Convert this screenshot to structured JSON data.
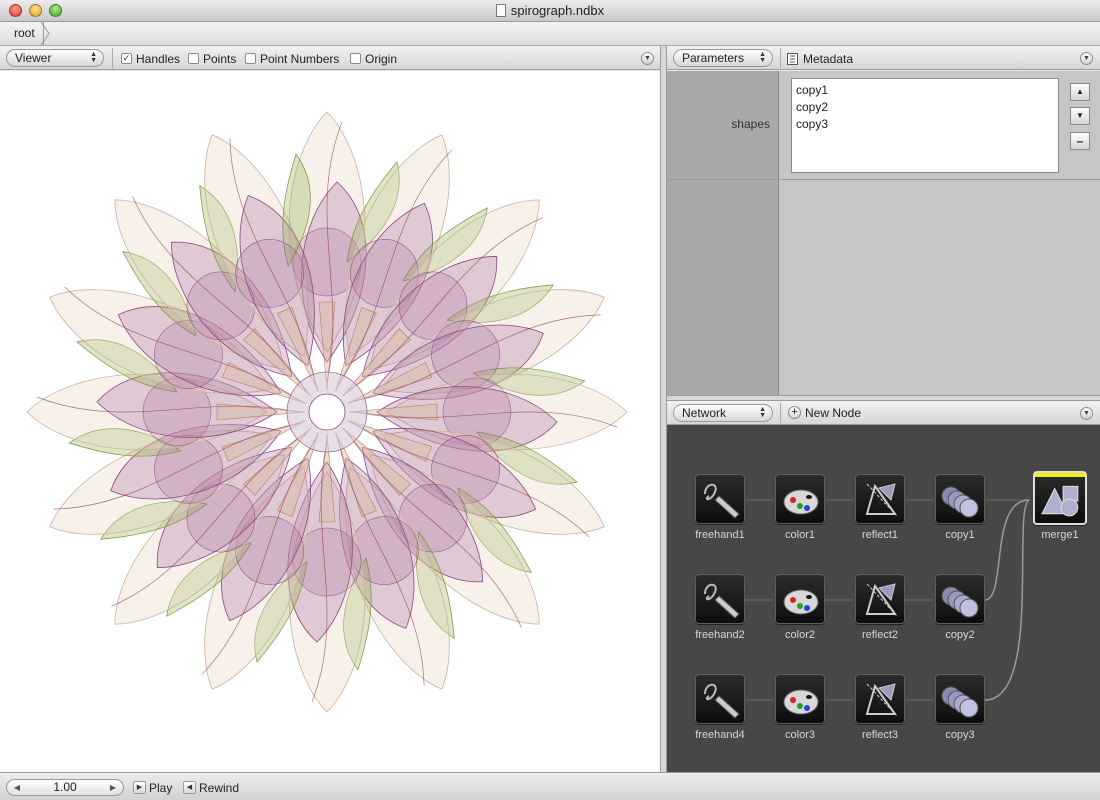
{
  "window": {
    "title": "spirograph.ndbx"
  },
  "breadcrumb": {
    "root": "root"
  },
  "viewer_pane": {
    "mode": "Viewer",
    "options": [
      {
        "label": "Handles",
        "checked": true
      },
      {
        "label": "Points",
        "checked": false
      },
      {
        "label": "Point Numbers",
        "checked": false
      },
      {
        "label": "Origin",
        "checked": false
      }
    ]
  },
  "parameters_pane": {
    "mode": "Parameters",
    "tab": "Metadata",
    "shapes_label": "shapes",
    "shapes": [
      "copy1",
      "copy2",
      "copy3"
    ]
  },
  "network_pane": {
    "mode": "Network",
    "new_node": "New Node",
    "nodes": {
      "freehand1": "freehand1",
      "color1": "color1",
      "reflect1": "reflect1",
      "copy1": "copy1",
      "freehand2": "freehand2",
      "color2": "color2",
      "reflect2": "reflect2",
      "copy2": "copy2",
      "freehand4": "freehand4",
      "color3": "color3",
      "reflect3": "reflect3",
      "copy3": "copy3",
      "merge1": "merge1"
    }
  },
  "playback": {
    "frame": "1.00",
    "play": "Play",
    "rewind": "Rewind"
  },
  "colors": {
    "rendered_node_bar": "#f2f200",
    "network_bg": "#474747",
    "petal_purple": "#a3619a",
    "petal_green": "#9cb55a"
  }
}
